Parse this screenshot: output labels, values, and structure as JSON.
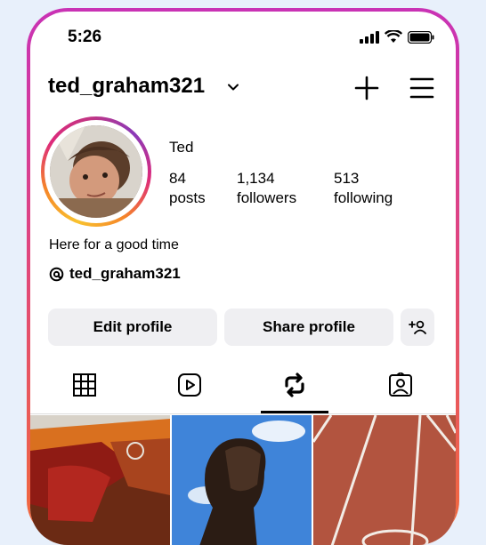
{
  "status": {
    "time": "5:26",
    "icons": [
      "signal-icon",
      "wifi-icon",
      "battery-icon"
    ]
  },
  "header": {
    "username": "ted_graham321",
    "icons": [
      "chevron-down-icon",
      "plus-icon",
      "menu-icon"
    ]
  },
  "profile": {
    "display_name": "Ted",
    "stats": [
      {
        "value": "84",
        "label": "posts"
      },
      {
        "value": "1,134",
        "label": "followers"
      },
      {
        "value": "513",
        "label": "following"
      }
    ],
    "bio": "Here for a good time",
    "threads_handle": "ted_graham321"
  },
  "actions": {
    "edit": "Edit profile",
    "share": "Share profile"
  },
  "tabs": [
    "grid-icon",
    "reels-icon",
    "reposts-icon",
    "tagged-icon"
  ],
  "colors": {
    "accent_gradient": [
      "#c932b5",
      "#e0457e",
      "#f26b3a"
    ],
    "button_bg": "#efeff2"
  }
}
